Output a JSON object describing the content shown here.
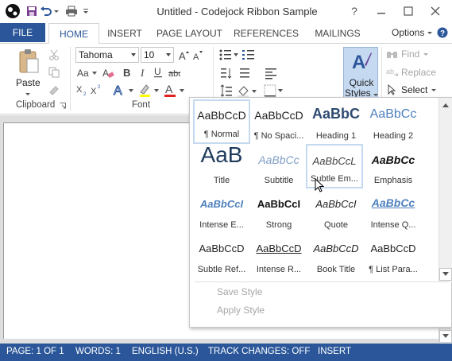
{
  "window": {
    "title": "Untitled - Codejock Ribbon Sample",
    "help_icon": "question-icon",
    "controls": [
      "minimize-icon",
      "restore-icon",
      "close-icon"
    ]
  },
  "quick_access": {
    "items": [
      "save-icon",
      "undo-icon",
      "print-icon",
      "customize-icon"
    ]
  },
  "tabs": {
    "file": "FILE",
    "items": [
      {
        "label": "HOME",
        "active": true
      },
      {
        "label": "INSERT",
        "active": false
      },
      {
        "label": "PAGE LAYOUT",
        "active": false
      },
      {
        "label": "REFERENCES",
        "active": false
      },
      {
        "label": "MAILINGS",
        "active": false
      }
    ],
    "options": "Options"
  },
  "ribbon": {
    "clipboard": {
      "label": "Clipboard",
      "paste": "Paste"
    },
    "font": {
      "label": "Font",
      "font_name": "Tahoma",
      "font_size": "10"
    },
    "styles": {
      "quick_styles_line1": "Quick",
      "quick_styles_line2": "Styles"
    },
    "editing": {
      "find": "Find",
      "replace": "Replace",
      "select": "Select"
    }
  },
  "quick_styles_gallery": {
    "tiles": [
      {
        "sample": "AaBbCcD",
        "name": "¶ Normal",
        "state": "selected"
      },
      {
        "sample": "AaBbCcD",
        "name": "¶ No Spaci...",
        "state": "normal"
      },
      {
        "sample": "AaBbC",
        "name": "Heading 1",
        "state": "normal"
      },
      {
        "sample": "AaBbCc",
        "name": "Heading 2",
        "state": "normal"
      },
      {
        "sample": "AaB",
        "name": "Title",
        "state": "normal"
      },
      {
        "sample": "AaBbCc",
        "name": "Subtitle",
        "state": "normal"
      },
      {
        "sample": "AaBbCcL",
        "name": "Subtle Em...",
        "state": "hovered"
      },
      {
        "sample": "AaBbCc",
        "name": "Emphasis",
        "state": "normal"
      },
      {
        "sample": "AaBbCcI",
        "name": "Intense E...",
        "state": "normal"
      },
      {
        "sample": "AaBbCcI",
        "name": "Strong",
        "state": "normal"
      },
      {
        "sample": "AaBbCcI",
        "name": "Quote",
        "state": "normal"
      },
      {
        "sample": "AaBbCc",
        "name": "Intense Q...",
        "state": "normal"
      },
      {
        "sample": "AaBbCcD",
        "name": "Subtle Ref...",
        "state": "normal"
      },
      {
        "sample": "AaBbCcD",
        "name": "Intense R...",
        "state": "normal"
      },
      {
        "sample": "AaBbCcD",
        "name": "Book Title",
        "state": "normal"
      },
      {
        "sample": "AaBbCcD",
        "name": "¶ List Para...",
        "state": "normal"
      }
    ],
    "menu": {
      "save_style": "Save Style",
      "apply_style": "Apply Style"
    }
  },
  "statusbar": {
    "page": "PAGE: 1 OF 1",
    "words": "WORDS: 1",
    "language": "ENGLISH (U.S.)",
    "track_changes": "TRACK CHANGES: OFF",
    "mode": "INSERT"
  },
  "colors": {
    "accent": "#2b579a",
    "highlight": "#c5d9f1",
    "font_color_bar": "#e02020"
  }
}
